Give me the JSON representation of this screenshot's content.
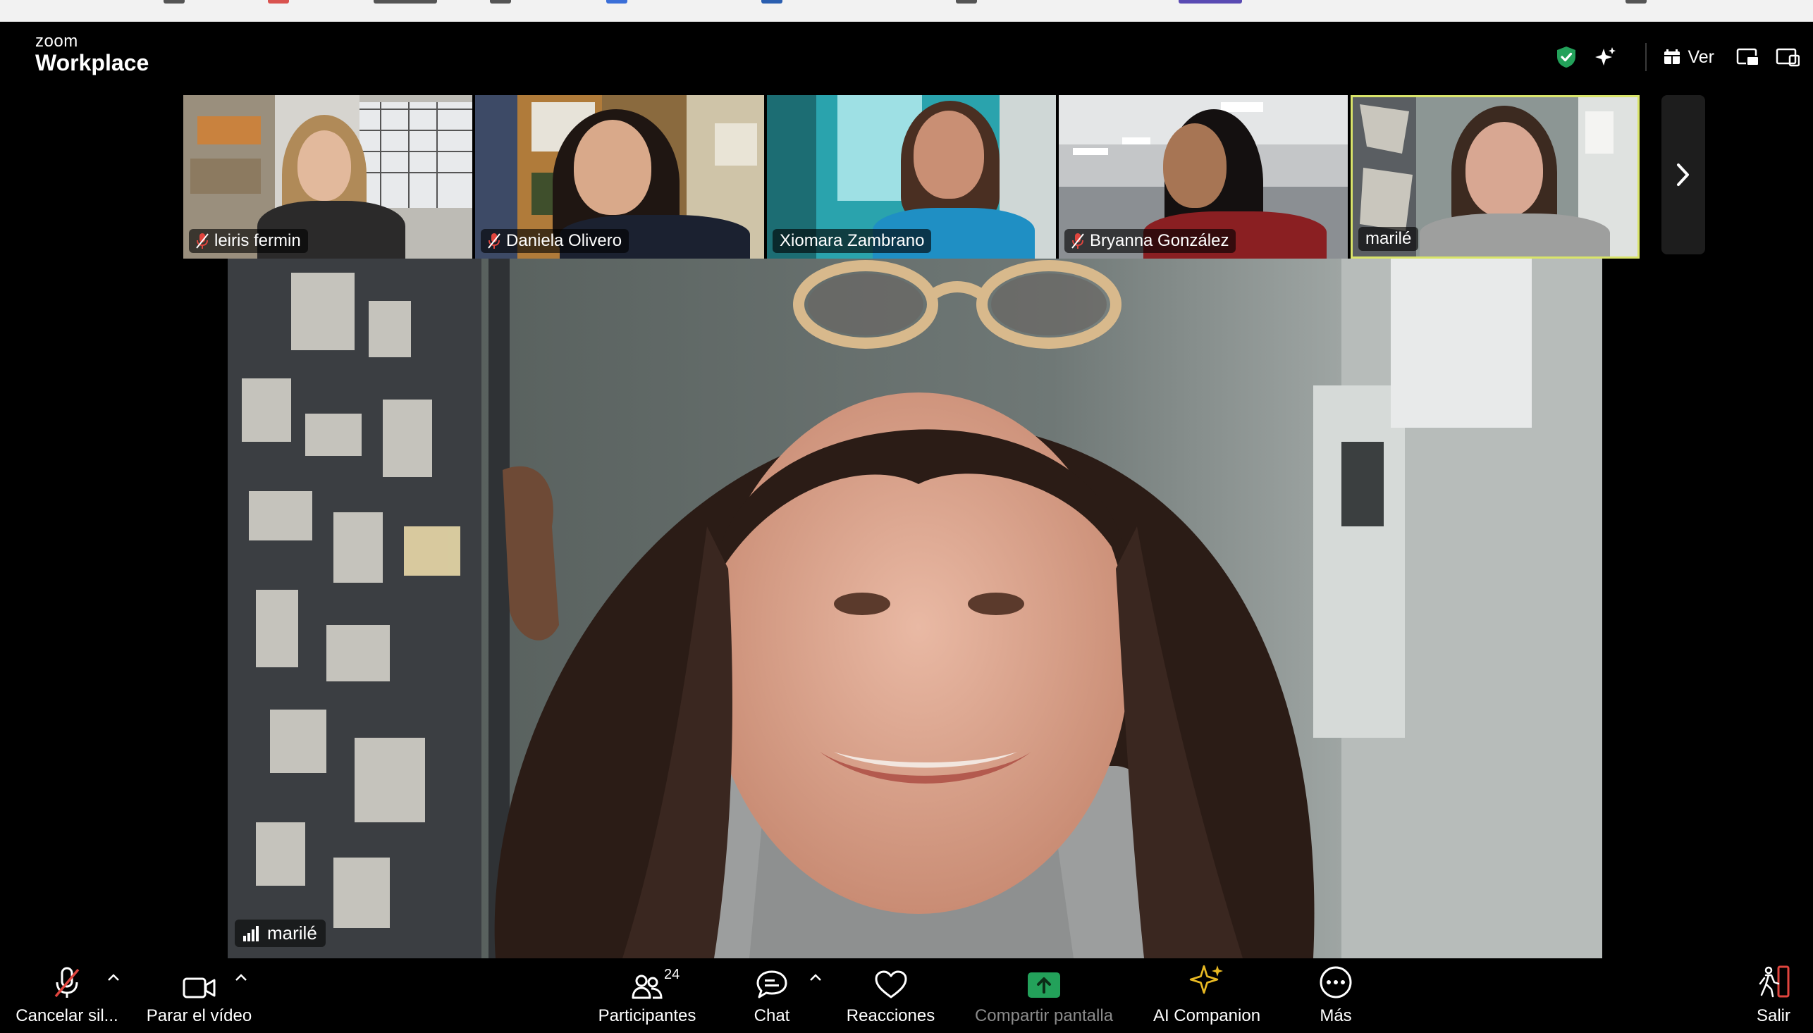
{
  "app": {
    "brand_small": "zoom",
    "brand_large": "Workplace",
    "view_label": "Ver"
  },
  "participants_strip": [
    {
      "name": "leiris fermin",
      "muted": true,
      "active": false
    },
    {
      "name": "Daniela Olivero",
      "muted": true,
      "active": false
    },
    {
      "name": "Xiomara Zambrano",
      "muted": false,
      "active": false
    },
    {
      "name": "Bryanna González",
      "muted": true,
      "active": false
    },
    {
      "name": "marilé",
      "muted": false,
      "active": true
    }
  ],
  "main_speaker": {
    "name": "marilé"
  },
  "toolbar": {
    "mute_label": "Cancelar sil...",
    "video_label": "Parar el vídeo",
    "participants_label": "Participantes",
    "participants_count": "24",
    "chat_label": "Chat",
    "reactions_label": "Reacciones",
    "share_label": "Compartir pantalla",
    "ai_label": "AI Companion",
    "more_label": "Más",
    "leave_label": "Salir"
  },
  "colors": {
    "accent_green": "#23a15a",
    "active_border": "#d9e46a",
    "muted_red": "#e0453e",
    "ai_gold": "#e8b923",
    "leave_red": "#e0453e"
  }
}
